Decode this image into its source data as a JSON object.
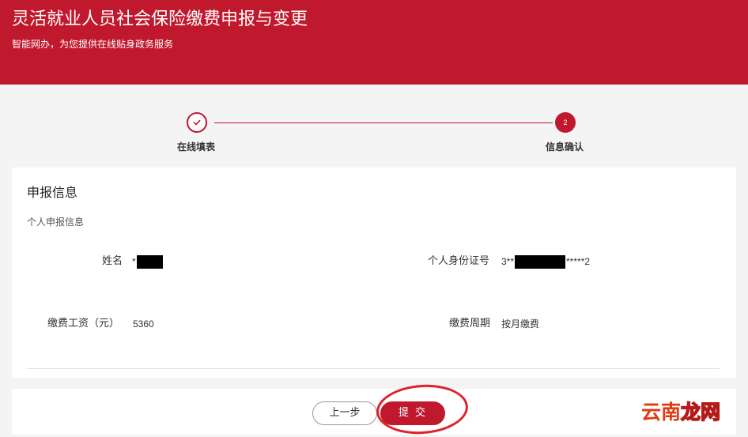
{
  "header": {
    "title": "灵活就业人员社会保险缴费申报与变更",
    "subtitle": "智能网办，为您提供在线贴身政务服务"
  },
  "steps": [
    {
      "label": "在线填表",
      "status": "done"
    },
    {
      "label": "信息确认",
      "number": "2",
      "status": "active"
    }
  ],
  "panel": {
    "title": "申报信息",
    "subtitle": "个人申报信息",
    "fields": {
      "name_label": "姓名",
      "name_value_prefix": "*",
      "id_label": "个人身份证号",
      "id_value_prefix": "3**",
      "id_value_suffix": "*****2",
      "wage_label": "缴费工资（元）",
      "wage_value": "5360",
      "period_label": "缴费周期",
      "period_value": "按月缴费"
    }
  },
  "buttons": {
    "prev": "上一步",
    "submit": "提 交"
  },
  "watermark": {
    "part1": "云南",
    "part2": "龙网"
  },
  "colors": {
    "brand": "#c0182c",
    "annotation_ring": "#e0202a"
  }
}
